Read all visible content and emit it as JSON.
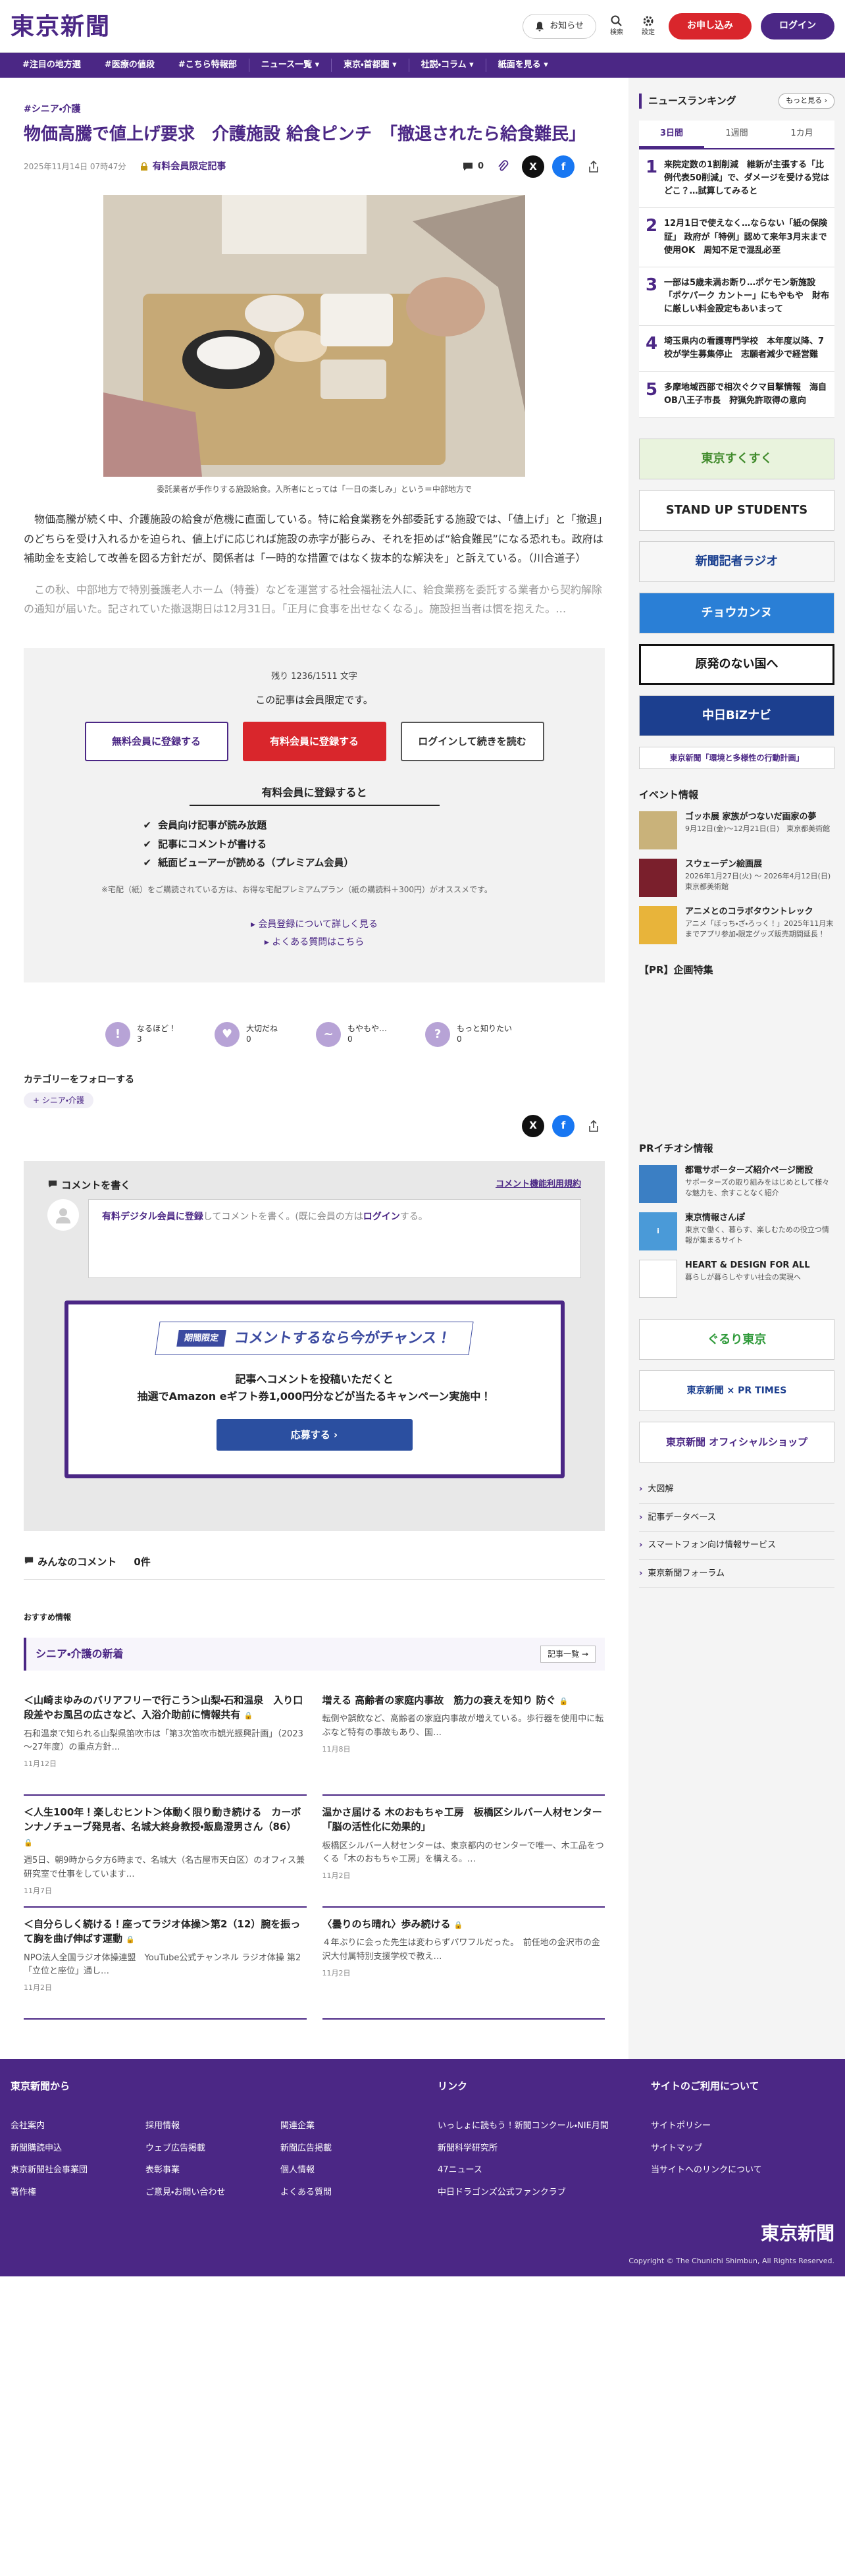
{
  "header": {
    "logo": "東京新聞",
    "notice_label": "お知らせ",
    "search_label": "検索",
    "settings_label": "設定",
    "apply_label": "お申し込み",
    "login_label": "ログイン"
  },
  "nav": {
    "items": [
      "#注目の地方選",
      "#医療の値段",
      "#こちら特報部",
      "ニュース一覧 ▾",
      "東京・首都圏 ▾",
      "社説・コラム ▾",
      "紙面を見る ▾"
    ]
  },
  "article": {
    "category": "#シニア・介護",
    "title": "物価高騰で値上げ要求　介護施設 給食ピンチ　「撤退されたら給食難民」",
    "date": "2025年11月14日 07時47分",
    "paid_label": "有料会員限定記事",
    "comment_count": "0",
    "photo_caption": "委託業者が手作りする施設給食。入所者にとっては「一日の楽しみ」という＝中部地方で",
    "para1": "物価高騰が続く中、介護施設の給食が危機に直面している。特に給食業務を外部委託する施設では、「値上げ」と「撤退」のどちらを受け入れるかを迫られ、値上げに応じれば施設の赤字が膨らみ、それを拒めば“給食難民”になる恐れも。政府は補助金を支給して改善を図る方針だが、関係者は「一時的な措置ではなく抜本的な解決を」と訴えている。（川合道子）",
    "para2": "この秋、中部地方で特別養護老人ホーム（特養）などを運営する社会福祉法人に、給食業務を委託する業者から契約解除の通知が届いた。記されていた撤退期日は12月31日。「正月に食事を出せなくなる」。施設担当者は慣を抱えた。…"
  },
  "paywall": {
    "count": "残り 1236/1511 文字",
    "title": "この記事は会員限定です。",
    "btn_free": "無料会員に登録する",
    "btn_paid": "有料会員に登録する",
    "btn_login": "ログインして続きを読む",
    "subhead": "有料会員に登録すると",
    "benefits": [
      "会員向け記事が読み放題",
      "記事にコメントが書ける",
      "紙面ビューアーが読める（プレミアム会員）"
    ],
    "note": "※宅配（紙）をご購読されている方は、お得な宅配プレミアムプラン（紙の購読料＋300円）がオススメです。",
    "link1": "会員登録について詳しく見る",
    "link2": "よくある質問はこちら"
  },
  "reactions": [
    {
      "label": "なるほど！",
      "count": "3",
      "icon": "lightbulb-icon"
    },
    {
      "label": "大切だね",
      "count": "0",
      "icon": "heart-icon"
    },
    {
      "label": "もやもや…",
      "count": "0",
      "icon": "cloud-icon"
    },
    {
      "label": "もっと知りたい",
      "count": "0",
      "icon": "question-icon"
    }
  ],
  "follow": {
    "label": "カテゴリーをフォローする",
    "tag": "シニア・介護"
  },
  "comments": {
    "head": "コメントを書く",
    "rules": "コメント機能利用規約",
    "prompt_strong": "有料デジタル会員に登録",
    "prompt_mid": "してコメントを書く。(既に会員の方は",
    "prompt_login": "ログイン",
    "prompt_end": "する。",
    "campaign_badge": "期間限定",
    "campaign_title": "コメントするなら今がチャンス！",
    "campaign_text1": "記事へコメントを投稿いただくと",
    "campaign_text2": "抽選でAmazon eギフト券1,000円分などが当たるキャンペーン実施中！",
    "campaign_btn": "応募する ›",
    "all_label": "みんなのコメント",
    "all_count": "0件"
  },
  "recommend": {
    "label": "おすすめ情報",
    "section": "シニア・介護の新着",
    "more": "記事一覧 →",
    "items": [
      {
        "title": "＜山崎まゆみのバリアフリーで行こう＞山梨・石和温泉　入り口段差やお風呂の広さなど、入浴介助前に情報共有",
        "lead": "石和温泉で知られる山梨県笛吹市は「第3次笛吹市観光振興計画」（2023～27年度）の重点方針…",
        "date": "11月12日"
      },
      {
        "title": "増える 高齢者の家庭内事故　筋力の衰えを知り 防ぐ",
        "lead": "転倒や誤飲など、高齢者の家庭内事故が増えている。歩行器を使用中に転ぶなど特有の事故もあり、国…",
        "date": "11月8日"
      },
      {
        "title": "＜人生100年！楽しむヒント＞体動く限り動き続ける　カーボンナノチューブ発見者、名城大終身教授・飯島澄男さん（86）",
        "lead": "週5日、朝9時から夕方6時まで、名城大（名古屋市天白区）のオフィス兼研究室で仕事をしています…",
        "date": "11月7日"
      },
      {
        "title": "温かさ届ける 木のおもちゃ工房　板橋区シルバー人材センター「脳の活性化に効果的」",
        "lead": "板橋区シルバー人材センターは、東京都内のセンターで唯一、木工品をつくる「木のおもちゃ工房」を構える。…",
        "date": "11月2日"
      },
      {
        "title": "＜自分らしく続ける！座ってラジオ体操＞第2（12）腕を振って胸を曲げ伸ばす運動",
        "lead": "NPO法人全国ラジオ体操連盟　YouTube公式チャンネル ラジオ体操 第2「立位と座位」通し…",
        "date": "11月2日"
      },
      {
        "title": "〈曇りのち晴れ〉歩み続ける",
        "lead": "４年ぶりに会った先生は変わらずパワフルだった。　前任地の金沢市の金沢大付属特別支援学校で教え…",
        "date": "11月2日"
      }
    ]
  },
  "sidebar": {
    "ranking_title": "ニュースランキング",
    "ranking_more": "もっと見る ›",
    "tabs": [
      "3日間",
      "1週間",
      "1カ月"
    ],
    "ranking": [
      {
        "num": "1",
        "title": "来院定数の1割削減　維新が主張する「比例代表50削減」で、ダメージを受ける党はどこ？…試算してみると"
      },
      {
        "num": "2",
        "title": "12月1日で使えなく…ならない「紙の保険証」 政府が「特例」認めて来年3月末まで使用OK　周知不足で混乱必至"
      },
      {
        "num": "3",
        "title": "一部は5歳未満お断り…ポケモン新施設「ポケパーク カントー」にもやもや　財布に厳しい料金設定もあいまって"
      },
      {
        "num": "4",
        "title": "埼玉県内の看護専門学校　本年度以降、7校が学生募集停止　志願者減少で経営難"
      },
      {
        "num": "5",
        "title": "多摩地域西部で相次ぐクマ目撃情報　海自OB八王子市長　狩猟免許取得の意向"
      }
    ],
    "banners": [
      "東京すくすく",
      "STAND UP STUDENTS",
      "新聞記者ラジオ",
      "チョウカンヌ",
      "原発のない国へ",
      "中日BiZナビ",
      "東京新聞「環境と多様性の行動計画」"
    ],
    "event_title": "イベント情報",
    "events": [
      {
        "title": "ゴッホ展 家族がつないだ画家の夢",
        "date": "9月12日(金)～12月21日(日)　東京都美術館",
        "color": "#c9b27a"
      },
      {
        "title": "スウェーデン絵画展",
        "date": "2026年1月27日(火) ～ 2026年4月12日(日)　東京都美術館",
        "color": "#7a1f2c"
      },
      {
        "title": "アニメとのコラボタウントレック",
        "date": "アニメ「ぼっち・ざ・ろっく！」2025年11月末までアプリ参加・限定グッズ販売期間延長！",
        "color": "#e8b43a"
      }
    ],
    "pr_title": "【PR】企画特集",
    "pr_info_title": "PRイチオシ情報",
    "pr_items": [
      {
        "title": "都電サポーターズ紹介ページ開設",
        "desc": "サポーターズの取り組みをはじめとして様々な魅力を、余すことなく紹介"
      },
      {
        "title": "東京情報さんぽ",
        "desc": "東京で働く、暮らす、楽しむための役立つ情報が集まるサイト"
      },
      {
        "title": "HEART & DESIGN FOR ALL",
        "desc": "暮らしが暮らしやすい社会の実現へ"
      }
    ],
    "banners2": [
      "ぐるり東京",
      "東京新聞 × PR TIMES",
      "東京新聞 オフィシャルショップ"
    ],
    "links": [
      "大図解",
      "記事データベース",
      "スマートフォン向け情報サービス",
      "東京新聞フォーラム"
    ]
  },
  "footer": {
    "col1_title": "東京新聞から",
    "col1_links": [
      "会社案内",
      "採用情報",
      "関連企業",
      "新聞購読申込",
      "ウェブ広告掲載",
      "新聞広告掲載",
      "東京新聞社会事業団",
      "表彰事業",
      "個人情報",
      "著作権",
      "ご意見・お問い合わせ",
      "よくある質問"
    ],
    "col2_title": "リンク",
    "col2_links": [
      "いっしょに読もう！新聞コンクール・NIE月間",
      "新聞科学研究所",
      "47ニュース",
      "中日ドラゴンズ公式ファンクラブ"
    ],
    "col3_title": "サイトのご利用について",
    "col3_links": [
      "サイトポリシー",
      "サイトマップ",
      "当サイトへのリンクについて"
    ],
    "logo": "東京新聞",
    "copyright": "Copyright © The Chunichi Shimbun, All Rights Reserved."
  }
}
